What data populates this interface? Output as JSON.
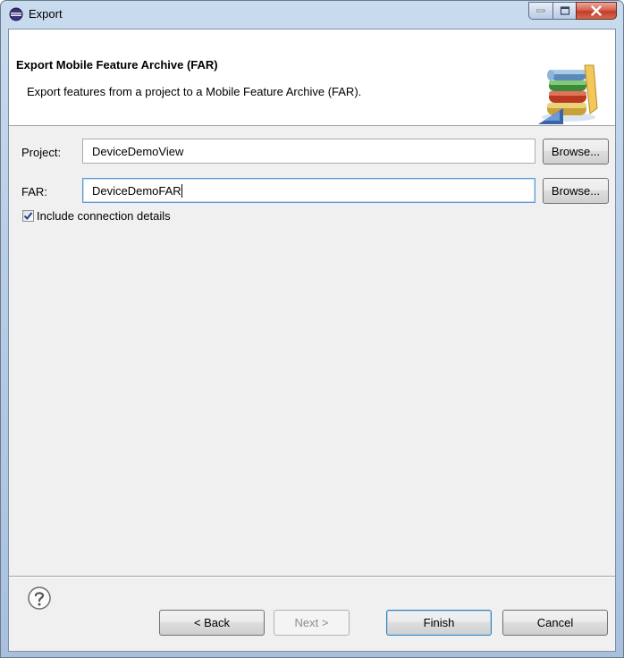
{
  "window": {
    "title": "Export"
  },
  "banner": {
    "title": "Export Mobile Feature Archive (FAR)",
    "description": "Export features from a project to a Mobile Feature Archive (FAR)."
  },
  "form": {
    "project": {
      "label": "Project:",
      "value": "DeviceDemoView",
      "browse_label": "Browse..."
    },
    "far": {
      "label": "FAR:",
      "value": "DeviceDemoFAR",
      "browse_label": "Browse..."
    },
    "include_connection": {
      "label": "Include connection details",
      "checked": true
    }
  },
  "footer": {
    "help_icon": "help-icon",
    "back_label": "< Back",
    "next_label": "Next >",
    "finish_label": "Finish",
    "cancel_label": "Cancel"
  },
  "colors": {
    "title_gradient_top": "#c9dbee",
    "dialog_bg": "#f0f0f0",
    "close_red": "#c13d29",
    "focus_blue": "#5b9bd5"
  }
}
